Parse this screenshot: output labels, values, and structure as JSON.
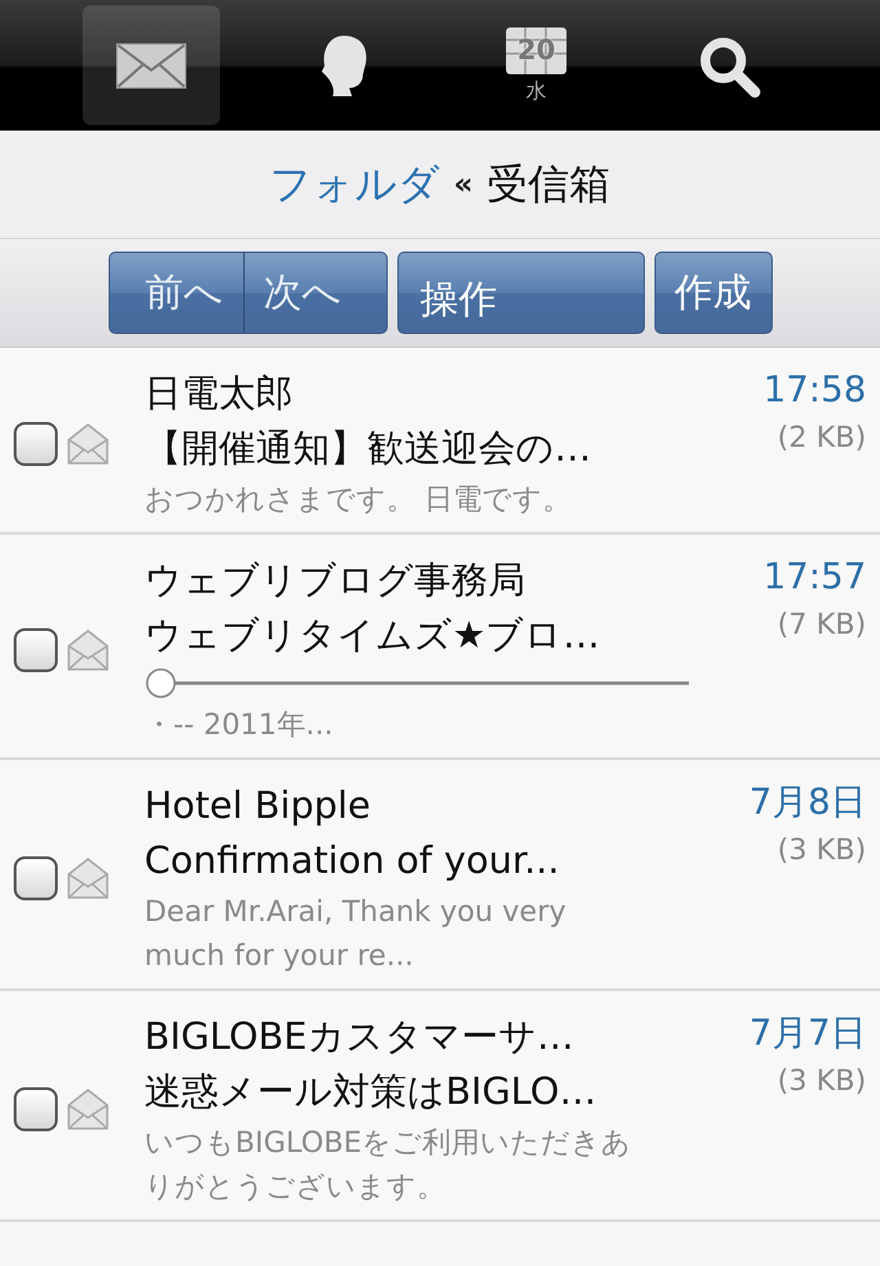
{
  "tabs": [
    {
      "kind": "mail",
      "selected": true
    },
    {
      "kind": "contacts",
      "selected": false
    },
    {
      "kind": "calendar",
      "selected": false,
      "day": "20",
      "weekday": "水"
    },
    {
      "kind": "search",
      "selected": false
    }
  ],
  "header": {
    "link": "フォルダ",
    "separator": "«",
    "title": "受信箱"
  },
  "toolbar": {
    "segmented": [
      "前へ",
      "次へ"
    ],
    "action": "操作",
    "compose": "作成"
  },
  "messages": [
    {
      "sender": "日電太郎",
      "subject": "【開催通知】歓送迎会の…",
      "preview": "おつかれさまです。 日電です。",
      "time": "17:58",
      "size": "(2 KB)",
      "checked": false,
      "rule": false
    },
    {
      "sender": "ウェブリブログ事務局",
      "subject": "ウェブリタイムズ★ブロ…",
      "preview": "・-- 2011年...",
      "time": "17:57",
      "size": "(7 KB)",
      "checked": false,
      "rule": true
    },
    {
      "sender": "Hotel Bipple",
      "subject": "Confirmation of your...",
      "preview": "Dear Mr.Arai, Thank you very much for your re...",
      "time": "7月8日",
      "size": "(3 KB)",
      "checked": false,
      "rule": false
    },
    {
      "sender": "BIGLOBEカスタマーサ…",
      "subject": "迷惑メール対策はBIGLO…",
      "preview": "いつもBIGLOBEをご利用いただきありがとうございます。",
      "time": "7月7日",
      "size": "(3 KB)",
      "checked": false,
      "rule": false
    }
  ]
}
